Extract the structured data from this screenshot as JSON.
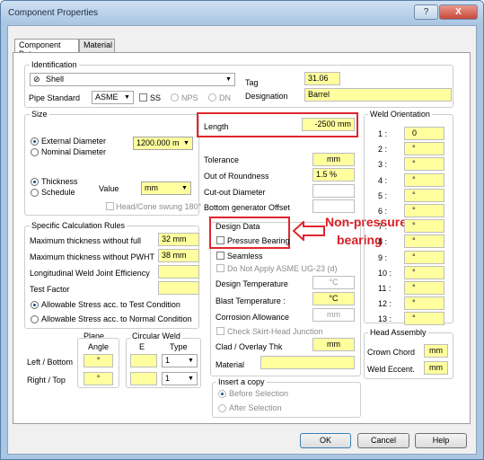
{
  "window": {
    "title": "Component Properties",
    "help_glyph": "?",
    "close_glyph": "X"
  },
  "tabs": [
    "Component Data",
    "Material"
  ],
  "identification": {
    "group": "Identification",
    "component": "Shell",
    "tag_label": "Tag",
    "tag_value": "31.06",
    "designation_label": "Designation",
    "designation_value": "Barrel",
    "pipe_standard_label": "Pipe Standard",
    "pipe_standard_value": "ASME",
    "ss": "SS",
    "nps": "NPS",
    "dn": "DN"
  },
  "size": {
    "group": "Size",
    "external_diameter": "External Diameter",
    "nominal_diameter": "Nominal Diameter",
    "diameter_value": "1200.000 m",
    "thickness": "Thickness",
    "schedule": "Schedule",
    "value_label": "Value",
    "value_unit": "mm",
    "head_cone": "Head/Cone swung 180°"
  },
  "props": {
    "length_label": "Length",
    "length_value": "-2500 mm",
    "tolerance_label": "Tolerance",
    "tolerance_value": "mm",
    "out_of_roundness_label": "Out of Roundness",
    "out_of_roundness_value": "1.5 %",
    "cutout_label": "Cut-out Diameter",
    "bottom_gen_label": "Bottom generator Offset"
  },
  "spec": {
    "group": "Specific Calculation Rules",
    "max_thick_label": "Maximum thickness without full",
    "max_thick_value": "32 mm",
    "max_pwht_label": "Maximum thickness without PWHT",
    "max_pwht_value": "38 mm",
    "long_weld_label": "Longitudinal Weld Joint Efficiency",
    "test_factor_label": "Test Factor",
    "allow_test": "Allowable Stress acc. to Test Condition",
    "allow_normal": "Allowable Stress acc. to Normal Condition"
  },
  "welds": {
    "plane": "Plane",
    "angle": "Angle",
    "circular_weld": "Circular Weld",
    "e": "E",
    "type": "Type",
    "left_bottom": "Left / Bottom",
    "right_top": "Right / Top",
    "deg": "°",
    "type_value": "1"
  },
  "design": {
    "group": "Design Data",
    "pressure_bearing": "Pressure Bearing",
    "seamless": "Seamless",
    "no_ug23": "Do Not Apply ASME UG-23 (d)",
    "design_temp_label": "Design Temperature",
    "design_temp_unit": "°C",
    "blast_temp_label": "Blast Temperature :",
    "blast_temp_unit": "°C",
    "corrosion_label": "Corrosion Allowance",
    "corrosion_unit": "mm",
    "skirt_head": "Check Skirt-Head Junction",
    "clad_label": "Clad / Overlay Thk",
    "clad_unit": "mm",
    "material_label": "Material"
  },
  "insert": {
    "group": "Insert a copy",
    "before": "Before Selection",
    "after": "After Selection"
  },
  "weld_orientation": {
    "group": "Weld Orientation",
    "rows": [
      {
        "label": "1 :",
        "value": "0"
      },
      {
        "label": "2 :",
        "value": "°"
      },
      {
        "label": "3 :",
        "value": "°"
      },
      {
        "label": "4 :",
        "value": "°"
      },
      {
        "label": "5 :",
        "value": "°"
      },
      {
        "label": "6 :",
        "value": "°"
      },
      {
        "label": "7 :",
        "value": "°"
      },
      {
        "label": "8 :",
        "value": "°"
      },
      {
        "label": "9 :",
        "value": "°"
      },
      {
        "label": "10 :",
        "value": "°"
      },
      {
        "label": "11 :",
        "value": "°"
      },
      {
        "label": "12 :",
        "value": "°"
      },
      {
        "label": "13 :",
        "value": "°"
      }
    ]
  },
  "head_assembly": {
    "group": "Head Assembly",
    "crown_label": "Crown Chord",
    "weld_ecc_label": "Weld Eccent.",
    "unit": "mm"
  },
  "buttons": {
    "ok": "OK",
    "cancel": "Cancel",
    "help": "Help"
  },
  "annotation": {
    "text_line1": "Non-pressure",
    "text_line2": "bearing",
    "color": "#e0262e"
  }
}
